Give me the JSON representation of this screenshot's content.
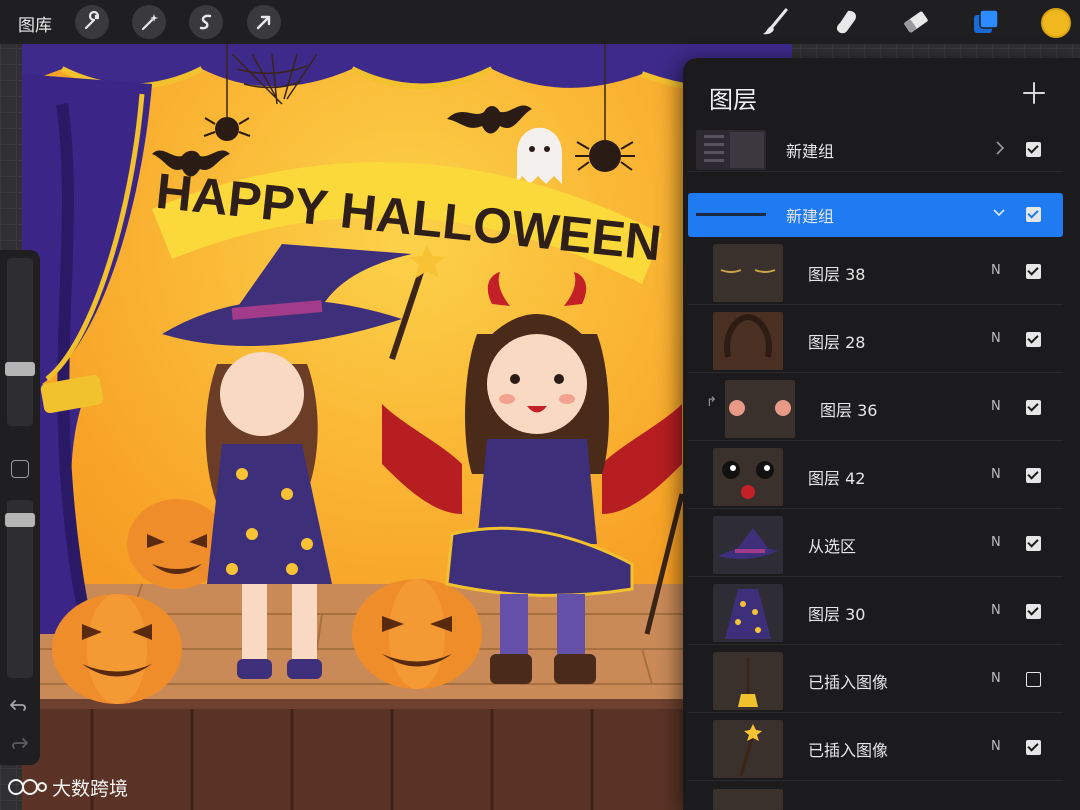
{
  "toolbar": {
    "gallery_label": "图库",
    "tools_left": [
      "wrench-icon",
      "magic-wand-icon",
      "selection-s-icon",
      "transform-arrow-icon"
    ],
    "tools_right": [
      "brush-icon",
      "smudge-icon",
      "eraser-icon",
      "layers-icon"
    ],
    "active_color": "#f0b81e"
  },
  "canvas": {
    "title": "HAPPY HALLOWEEN"
  },
  "layers_panel": {
    "title": "图层",
    "add_icon": "plus-icon",
    "layers": [
      {
        "label": "新建组",
        "type": "group",
        "expanded": false,
        "visible": true
      },
      {
        "label": "新建组",
        "type": "group",
        "expanded": true,
        "selected": true,
        "visible": true
      },
      {
        "label": "图层 38",
        "blend": "N",
        "visible": true
      },
      {
        "label": "图层 28",
        "blend": "N",
        "visible": true
      },
      {
        "label": "图层 36",
        "blend": "N",
        "visible": true,
        "clipped": true
      },
      {
        "label": "图层 42",
        "blend": "N",
        "visible": true
      },
      {
        "label": "从选区",
        "blend": "N",
        "visible": true
      },
      {
        "label": "图层 30",
        "blend": "N",
        "visible": true
      },
      {
        "label": "已插入图像",
        "blend": "N",
        "visible": false
      },
      {
        "label": "已插入图像",
        "blend": "N",
        "visible": true
      }
    ]
  },
  "watermark": "大数跨境"
}
